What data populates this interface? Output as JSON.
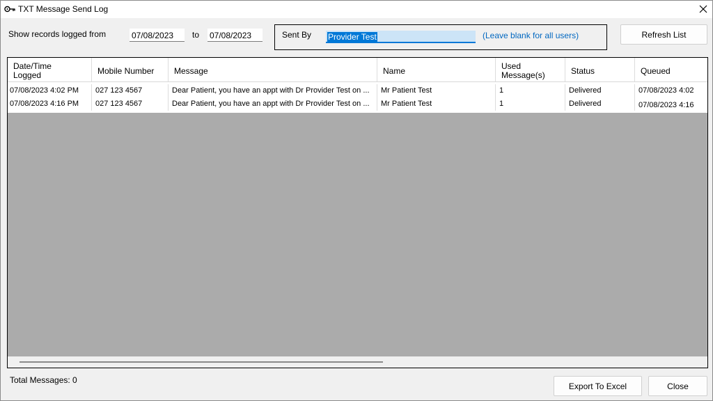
{
  "window": {
    "title": "TXT Message Send Log"
  },
  "filters": {
    "from_label": "Show records logged from",
    "from_date": "07/08/2023",
    "to_label": "to",
    "to_date": "07/08/2023",
    "sent_by_label": "Sent By",
    "sent_by_value": "Provider Test",
    "sent_by_hint": "(Leave blank for all users)",
    "refresh_label": "Refresh List"
  },
  "table": {
    "columns": [
      "Date/Time Logged",
      "Mobile Number",
      "Message",
      "Name",
      "Used Message(s)",
      "Status",
      "Queued"
    ],
    "rows": [
      [
        "07/08/2023 4:02 PM",
        "027 123 4567",
        "Dear Patient, you have an appt with Dr Provider Test on ...",
        "Mr Patient Test",
        "1",
        "Delivered",
        "07/08/2023 4:02"
      ],
      [
        "07/08/2023 4:16 PM",
        "027 123 4567",
        "Dear Patient, you have an appt with Dr Provider Test on ...",
        "Mr Patient Test",
        "1",
        "Delivered",
        "07/08/2023 4:16"
      ]
    ]
  },
  "footer": {
    "total_label": "Total Messages: 0",
    "export_label": "Export To Excel",
    "close_label": "Close"
  },
  "icons": {
    "app": "key-icon",
    "close": "close-icon"
  }
}
